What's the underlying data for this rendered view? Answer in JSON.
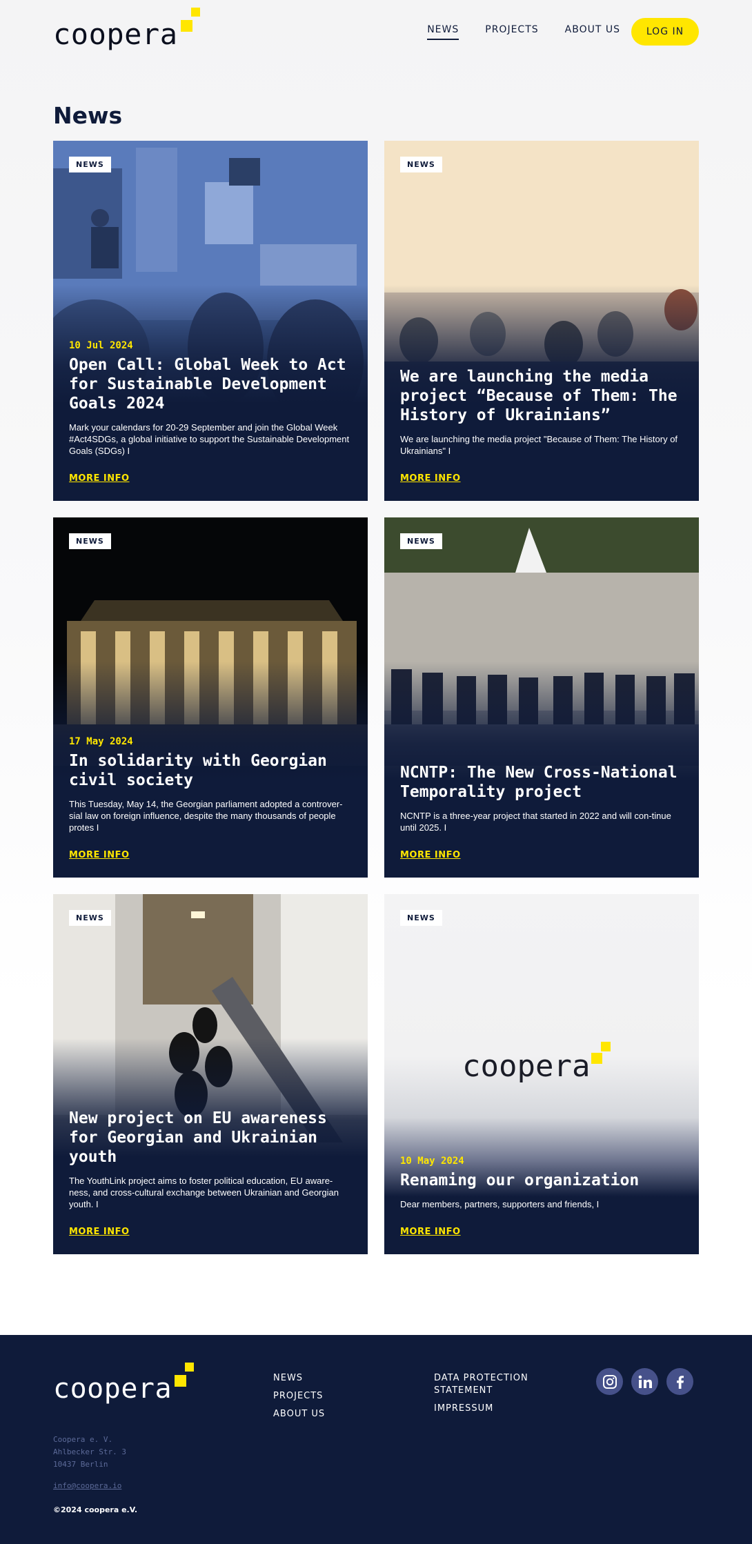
{
  "header": {
    "logo_text": "coopera",
    "nav": [
      {
        "label": "NEWS",
        "active": true
      },
      {
        "label": "PROJECTS",
        "active": false
      },
      {
        "label": "ABOUT US",
        "active": false
      }
    ],
    "login_label": "LOG IN"
  },
  "page_title": "News",
  "cards": [
    {
      "badge": "NEWS",
      "date": "10 Jul 2024",
      "title": "Open Call: Global Week to Act for Sustainable Development Goals 2024",
      "excerpt": "Mark your calendars for 20-29 September and join the Global Week #Act4SDGs, a global initiative to support the Sustainable Development Goals (SDGs) I",
      "more": "MORE INFO"
    },
    {
      "badge": "NEWS",
      "date": "",
      "title": "We are launching the media project “Because of Them: The History of Ukrainians”",
      "excerpt": "We are launching the media project \"Because of Them: The History of Ukrainians\" I",
      "more": "MORE INFO"
    },
    {
      "badge": "NEWS",
      "date": "17 May 2024",
      "title": "In solidarity with Georgian civil society",
      "excerpt": "This Tuesday, May 14, the Georgian parliament adopted a controver-sial law on foreign influence, despite the many thousands of people protes I",
      "more": "MORE INFO"
    },
    {
      "badge": "NEWS",
      "date": "",
      "title": "NCNTP: The New Cross-National Temporality project",
      "excerpt": "NCNTP is a three-year project that started in 2022 and will con-tinue until 2025. I",
      "more": "MORE INFO"
    },
    {
      "badge": "NEWS",
      "date": "",
      "title": "New project on EU awareness for Georgian and Ukrainian youth",
      "excerpt": "The YouthLink project aims to foster political education, EU aware-ness, and cross-cultural exchange between Ukrainian and Georgian youth. I",
      "more": "MORE INFO"
    },
    {
      "badge": "NEWS",
      "date": "10 May 2024",
      "title": "Renaming our organization",
      "excerpt": "Dear members, partners, supporters and friends, I",
      "more": "MORE INFO",
      "image_logo_text": "coopera"
    }
  ],
  "footer": {
    "logo_text": "coopera",
    "col1": [
      "NEWS",
      "PROJECTS",
      "ABOUT US"
    ],
    "col2": [
      "DATA PROTECTION STATEMENT",
      "IMPRESSUM"
    ],
    "socials": [
      "instagram-icon",
      "linkedin-icon",
      "facebook-icon"
    ],
    "address": [
      "Coopera e. V.",
      "Ahlbecker Str. 3",
      "10437 Berlin"
    ],
    "email": "info@coopera.io",
    "copyright": "©2024 coopera e.V."
  },
  "colors": {
    "navy": "#0f1b3a",
    "accent_yellow": "#ffe600",
    "social_circle": "#46518a"
  }
}
